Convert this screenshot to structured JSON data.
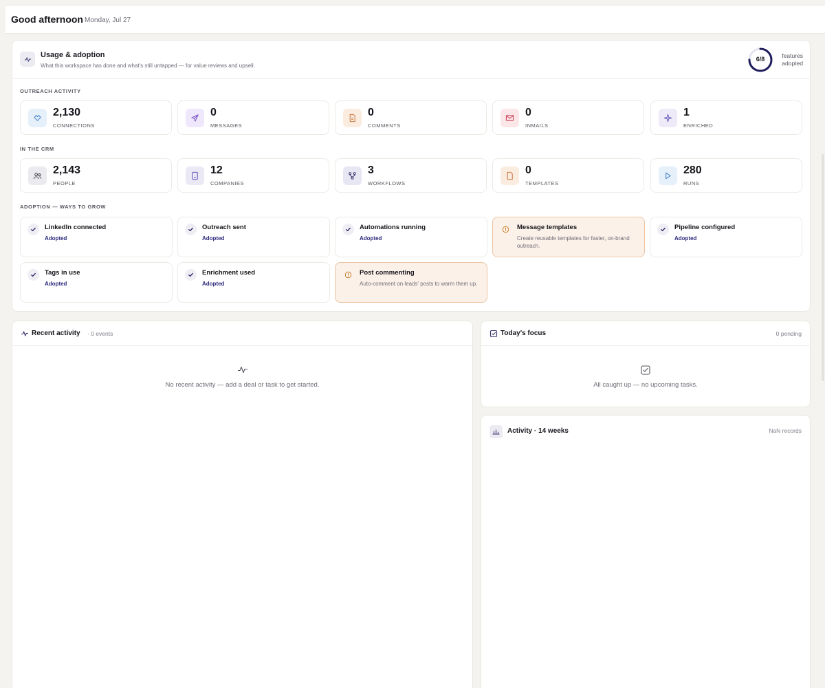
{
  "header": {
    "greeting": "Good afternoon",
    "date": "Monday, Jul 27"
  },
  "usage": {
    "title": "Usage & adoption",
    "subtitle": "What this workspace has done and what's still untapped — for value reviews and upsell.",
    "adopted_count": "6/8",
    "adopted_fraction": 0.75,
    "adopted_label_line1": "features",
    "adopted_label_line2": "adopted"
  },
  "outreach": {
    "label": "OUTREACH ACTIVITY",
    "stats": [
      {
        "value": "2,130",
        "label": "CONNECTIONS",
        "icon": "handshake-icon"
      },
      {
        "value": "0",
        "label": "MESSAGES",
        "icon": "send-icon"
      },
      {
        "value": "0",
        "label": "COMMENTS",
        "icon": "document-icon"
      },
      {
        "value": "0",
        "label": "INMAILS",
        "icon": "mail-icon"
      },
      {
        "value": "1",
        "label": "ENRICHED",
        "icon": "sparkle-icon"
      }
    ]
  },
  "crm": {
    "label": "IN THE CRM",
    "stats": [
      {
        "value": "2,143",
        "label": "PEOPLE",
        "icon": "people-icon"
      },
      {
        "value": "12",
        "label": "COMPANIES",
        "icon": "building-icon"
      },
      {
        "value": "3",
        "label": "WORKFLOWS",
        "icon": "workflow-icon"
      },
      {
        "value": "0",
        "label": "TEMPLATES",
        "icon": "file-icon"
      },
      {
        "value": "280",
        "label": "RUNS",
        "icon": "play-icon"
      }
    ]
  },
  "adoption": {
    "label": "ADOPTION — WAYS TO GROW",
    "features": [
      {
        "title": "LinkedIn connected",
        "status": "Adopted"
      },
      {
        "title": "Outreach sent",
        "status": "Adopted"
      },
      {
        "title": "Automations running",
        "status": "Adopted"
      },
      {
        "title": "Message templates",
        "desc": "Create reusable templates for faster, on-brand outreach."
      },
      {
        "title": "Pipeline configured",
        "status": "Adopted"
      },
      {
        "title": "Tags in use",
        "status": "Adopted"
      },
      {
        "title": "Enrichment used",
        "status": "Adopted"
      },
      {
        "title": "Post commenting",
        "desc": "Auto-comment on leads' posts to warm them up."
      }
    ]
  },
  "recent": {
    "title": "Recent activity",
    "meta": "· 0 events",
    "empty": "No recent activity — add a deal or task to get started."
  },
  "focus": {
    "title": "Today's focus",
    "meta": "0 pending",
    "empty": "All caught up — no upcoming tasks."
  },
  "activity_weeks": {
    "title": "Activity · 14 weeks",
    "meta": "NaN records"
  },
  "colors": {
    "accent": "#1f1c5c",
    "warn_bg": "#fbf1e9",
    "warn_border": "#ecc4a3"
  }
}
